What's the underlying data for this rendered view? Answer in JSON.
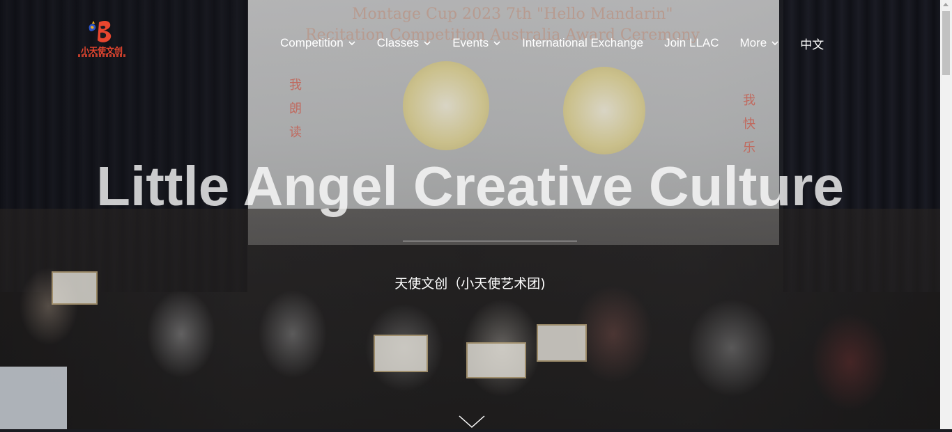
{
  "brand": {
    "logo_text": "小天使文创"
  },
  "nav": {
    "items": [
      {
        "label": "Competition",
        "has_dropdown": true
      },
      {
        "label": "Classes",
        "has_dropdown": true
      },
      {
        "label": "Events",
        "has_dropdown": true
      },
      {
        "label": "International Exchange",
        "has_dropdown": false
      },
      {
        "label": "Join LLAC",
        "has_dropdown": false
      },
      {
        "label": "More",
        "has_dropdown": true
      },
      {
        "label": "中文",
        "has_dropdown": false
      }
    ]
  },
  "hero": {
    "title": "Little Angel Creative Culture",
    "subtitle": "天使文创（小天使艺术团)",
    "background": {
      "screen_line1": "Montage Cup 2023 7th \"Hello Mandarin\"",
      "screen_line2": "Recitation Competition Australia Award Ceremony",
      "screen_side_left": "我朗读",
      "screen_side_right": "我快乐"
    }
  },
  "colors": {
    "nav_text": "#ffffff",
    "logo_red": "#e8462f",
    "logo_blue": "#2a54c9",
    "logo_yellow": "#f2b01e"
  },
  "icons": {
    "dropdown": "chevron-down-icon",
    "scroll": "chevron-down-icon"
  }
}
